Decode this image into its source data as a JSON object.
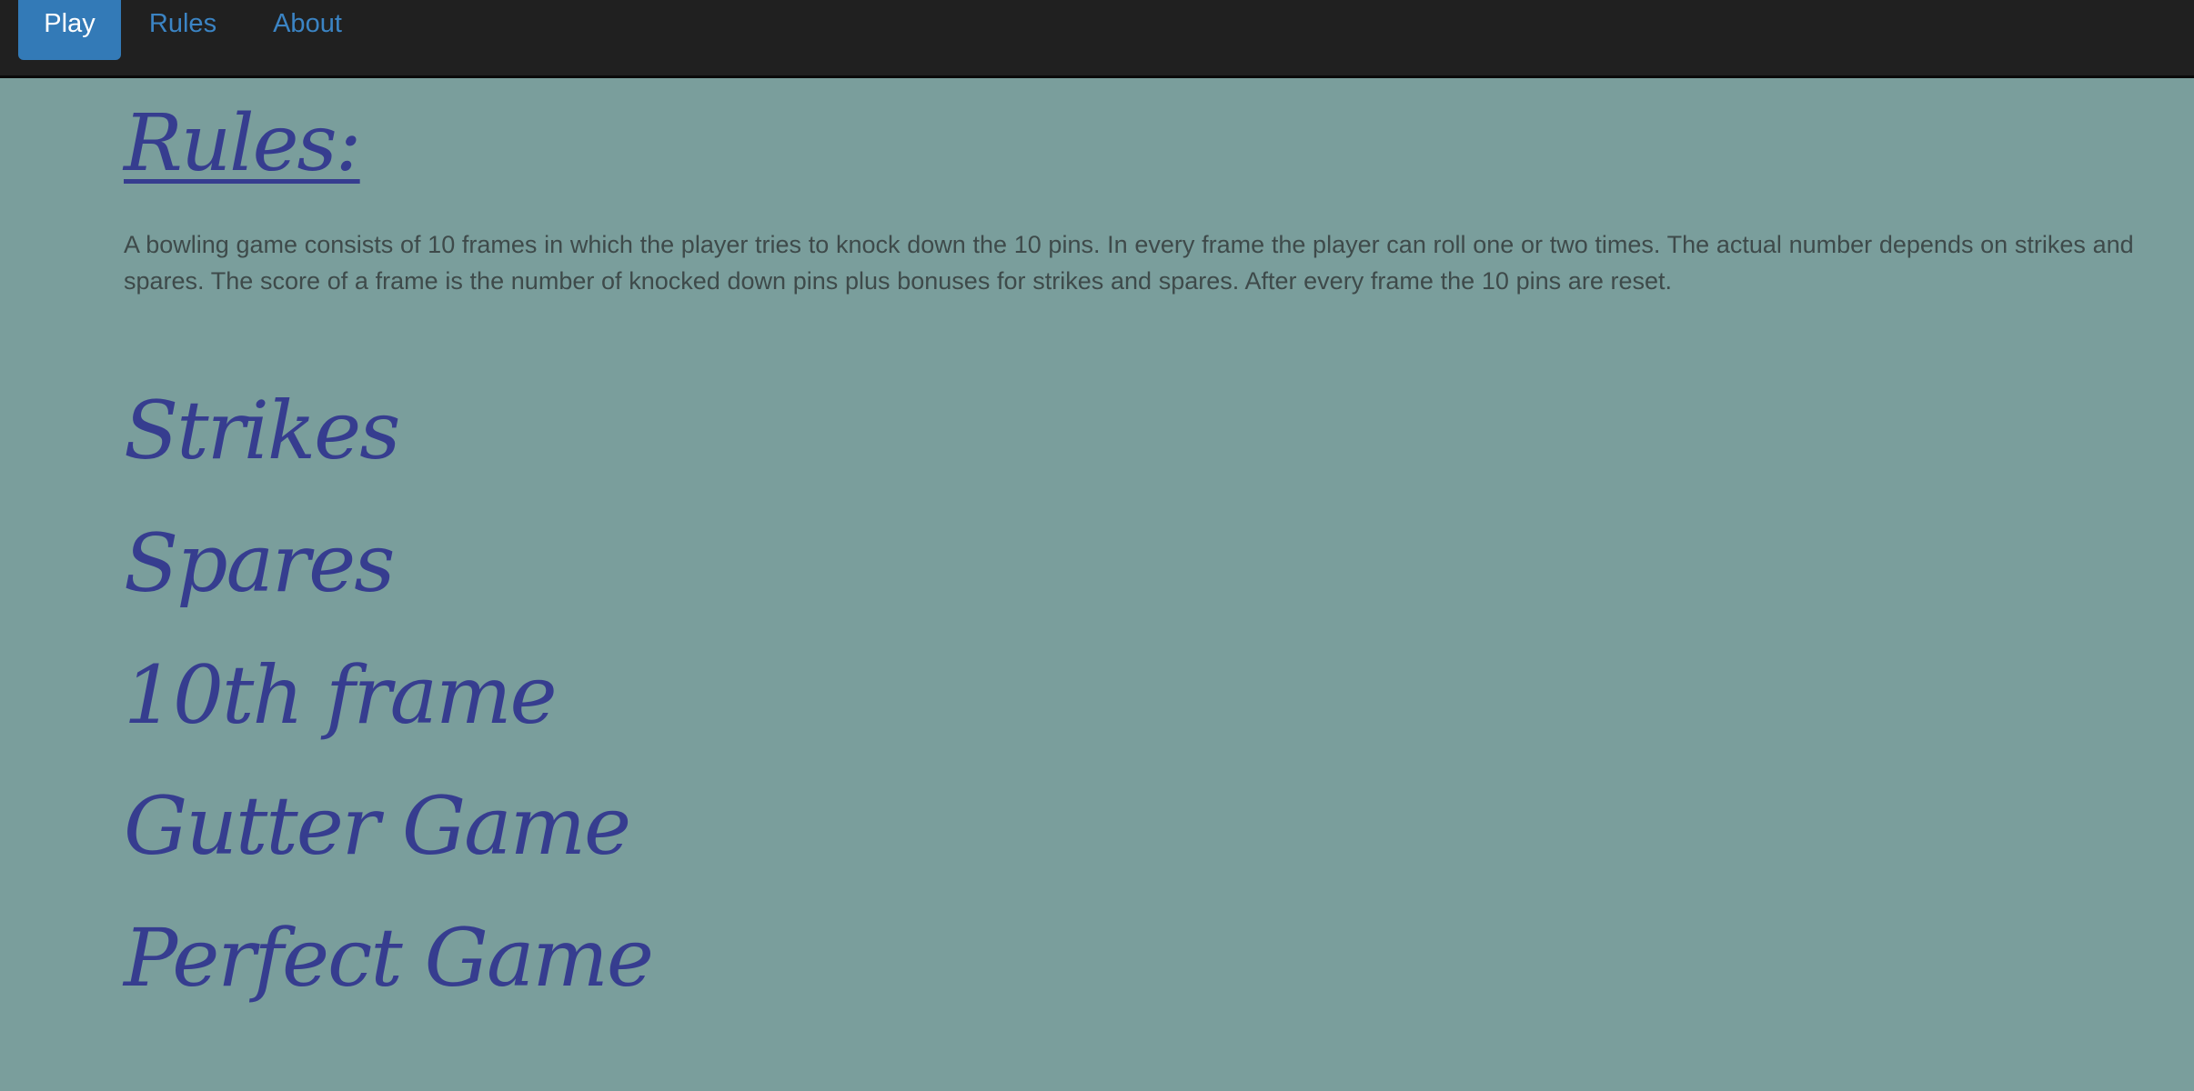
{
  "nav": {
    "items": [
      {
        "label": "Play",
        "active": true
      },
      {
        "label": "Rules",
        "active": false
      },
      {
        "label": "About",
        "active": false
      }
    ]
  },
  "rules": {
    "title": "Rules:",
    "intro": "A bowling game consists of 10 frames in which the player tries to knock down the 10 pins. In every frame the player can roll one or two times. The actual number depends on strikes and spares. The score of a frame is the number of knocked down pins plus bonuses for strikes and spares. After every frame the 10 pins are reset.",
    "sections": [
      {
        "heading": "Strikes"
      },
      {
        "heading": "Spares"
      },
      {
        "heading": "10th frame"
      },
      {
        "heading": "Gutter Game"
      },
      {
        "heading": "Perfect Game"
      }
    ]
  },
  "colors": {
    "background": "#7a9e9c",
    "navbar": "#202020",
    "active_tab": "#337ab7",
    "link": "#3b84c4",
    "heading": "#363d8f",
    "body_text": "#3e4a4a"
  }
}
